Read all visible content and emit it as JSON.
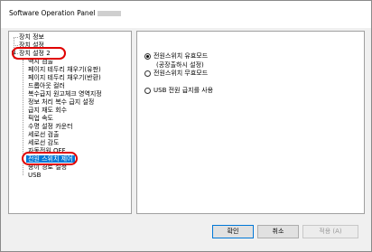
{
  "window": {
    "title": "Software Operation Panel"
  },
  "tree": {
    "items": [
      {
        "label": "장치 정보"
      },
      {
        "label": "장치 설정"
      },
      {
        "label": "장치 설정 2"
      },
      {
        "label": "백지 검출"
      },
      {
        "label": "페이지 테두리 채우기(유판)"
      },
      {
        "label": "페이지 테두리 채우기(반환)"
      },
      {
        "label": "드롭아웃 컬러"
      },
      {
        "label": "복수급지 원고체크 영역지정"
      },
      {
        "label": "정보 처리 복수 급지 설정"
      },
      {
        "label": "급지 재도 회수"
      },
      {
        "label": "픽업 속도"
      },
      {
        "label": "수명 설정 카운터"
      },
      {
        "label": "세로선 검출"
      },
      {
        "label": "세로선 감도"
      },
      {
        "label": "자동전원 OFF"
      },
      {
        "label": "전원 스위치 제어"
      },
      {
        "label": "종이 경로 설정"
      },
      {
        "label": "USB"
      }
    ]
  },
  "panel": {
    "options": [
      {
        "label": "전원스위치 유효모드",
        "sub": "(공장출하시 설정)",
        "checked": true
      },
      {
        "label": "전원스위치 무효모드",
        "checked": false
      },
      {
        "label": "USB 전원 급지를 사용",
        "checked": false
      }
    ]
  },
  "buttons": {
    "ok": "확인",
    "cancel": "취소",
    "apply": "적용 (A)"
  },
  "colors": {
    "annotation": "#e00000",
    "selection": "#0078d7"
  }
}
